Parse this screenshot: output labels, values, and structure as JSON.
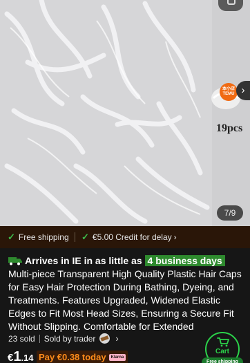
{
  "gallery": {
    "counter": "7/9",
    "pcs_label": "19pcs",
    "badge_line1": "本小店",
    "badge_line2": "TEMU",
    "next_icon": "chevron-right-icon",
    "photo_alt": "transparent plastic hair caps pile"
  },
  "banner": {
    "free_shipping": "Free shipping",
    "credit": "€5.00 Credit for delay",
    "check_icon": "check-icon",
    "accent_color": "#3dba4a",
    "background_color": "#2a1608"
  },
  "product": {
    "arrival_prefix": "Arrives in IE in as little as",
    "arrival_days": "4 business days",
    "title": "Multi-piece Transparent High Quality Plastic Hair Caps for Easy Hair Protection During Bathing, Dyeing, and Treatments. Features Upgraded, Widened Elastic Edges to Fit Most Head Sizes, Ensuring a Secure Fit Without Slipping. Comfortable for Extended"
  },
  "meta": {
    "sold": "23 sold",
    "sold_by": "Sold by trader"
  },
  "price": {
    "currency": "€",
    "integer": "1",
    "decimal": ".14",
    "pay_later": "Pay €0.38 today",
    "klarna": "Klarna",
    "color": "#ff8c1a"
  },
  "cart": {
    "label": "Cart",
    "free_shipping_tag": "Free shipping",
    "color": "#2bd34a"
  }
}
